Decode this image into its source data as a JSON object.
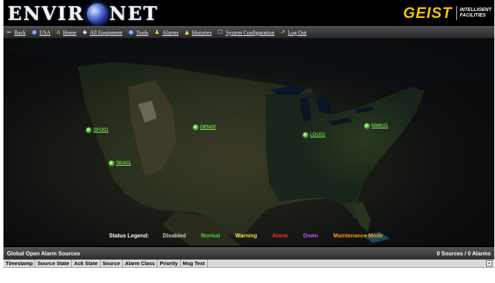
{
  "app": {
    "logo_left": "ENVIR",
    "logo_right": "NET",
    "brand_name": "GEIST",
    "brand_tagline": "INTELLIGENT FACILITIES"
  },
  "nav": [
    {
      "icon": "back-arrow-icon",
      "glyph": "←",
      "label": "Back"
    },
    {
      "icon": "usa-globe-icon",
      "glyph": "●",
      "label": "USA"
    },
    {
      "icon": "home-icon",
      "glyph": "⌂",
      "label": "Home"
    },
    {
      "icon": "equipment-icon",
      "glyph": "◆",
      "label": "All Equipment"
    },
    {
      "icon": "tools-icon",
      "glyph": "●",
      "label": "Tools"
    },
    {
      "icon": "alarm-bell-icon",
      "glyph": "♟",
      "label": "Alarms"
    },
    {
      "icon": "histories-icon",
      "glyph": "▲",
      "label": "Histories"
    },
    {
      "icon": "system-config-icon",
      "glyph": "☐",
      "label": "System Configuration"
    },
    {
      "icon": "logout-icon",
      "glyph": "↗",
      "label": "Log Out"
    }
  ],
  "map": {
    "sites": [
      {
        "label": "SFO01"
      },
      {
        "label": "DEN02"
      },
      {
        "label": "LOU01"
      },
      {
        "label": "NWK01"
      },
      {
        "label": "SEA01"
      }
    ]
  },
  "legend": {
    "title": "Status Legend:",
    "items": [
      {
        "label": "Disabled",
        "color": "#cfcfcf"
      },
      {
        "label": "Normal",
        "color": "#4fd13a"
      },
      {
        "label": "Warning",
        "color": "#ffe640"
      },
      {
        "label": "Alarm",
        "color": "#ff2b2b"
      },
      {
        "label": "Down",
        "color": "#c850ff"
      },
      {
        "label": "Maintenance Mode",
        "color": "#ff9a1f"
      }
    ]
  },
  "alarms": {
    "title": "Global Open Alarm Sources",
    "summary": "0 Sources / 0 Alarms",
    "columns": [
      "Timestamp",
      "Source State",
      "Ack State",
      "Source",
      "Alarm Class",
      "Priority",
      "Msg Text"
    ]
  }
}
